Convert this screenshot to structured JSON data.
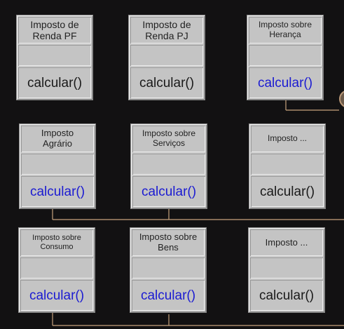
{
  "classes": [
    {
      "id": "pf",
      "name": "Imposto de\nRenda PF",
      "method": "calcular()",
      "highlight": false
    },
    {
      "id": "pj",
      "name": "Imposto de\nRenda PJ",
      "method": "calcular()",
      "highlight": false
    },
    {
      "id": "heranca",
      "name": "Imposto sobre\nHerança",
      "method": "calcular()",
      "highlight": true
    },
    {
      "id": "agrario",
      "name": "Imposto\nAgrário",
      "method": "calcular()",
      "highlight": true
    },
    {
      "id": "servicos",
      "name": "Imposto sobre\nServiços",
      "method": "calcular()",
      "highlight": true
    },
    {
      "id": "etc1",
      "name": "Imposto ...",
      "method": "calcular()",
      "highlight": false
    },
    {
      "id": "consumo",
      "name": "Imposto sobre\nConsumo",
      "method": "calcular()",
      "highlight": true
    },
    {
      "id": "bens",
      "name": "Imposto sobre\nBens",
      "method": "calcular()",
      "highlight": true
    },
    {
      "id": "etc2",
      "name": "Imposto ...",
      "method": "calcular()",
      "highlight": false
    }
  ],
  "colors": {
    "connector": "#c8a47e",
    "method_highlight": "#1b1bd2",
    "method_default": "#1a1a1a"
  },
  "icons": {
    "partial_circle": "circle-icon"
  }
}
